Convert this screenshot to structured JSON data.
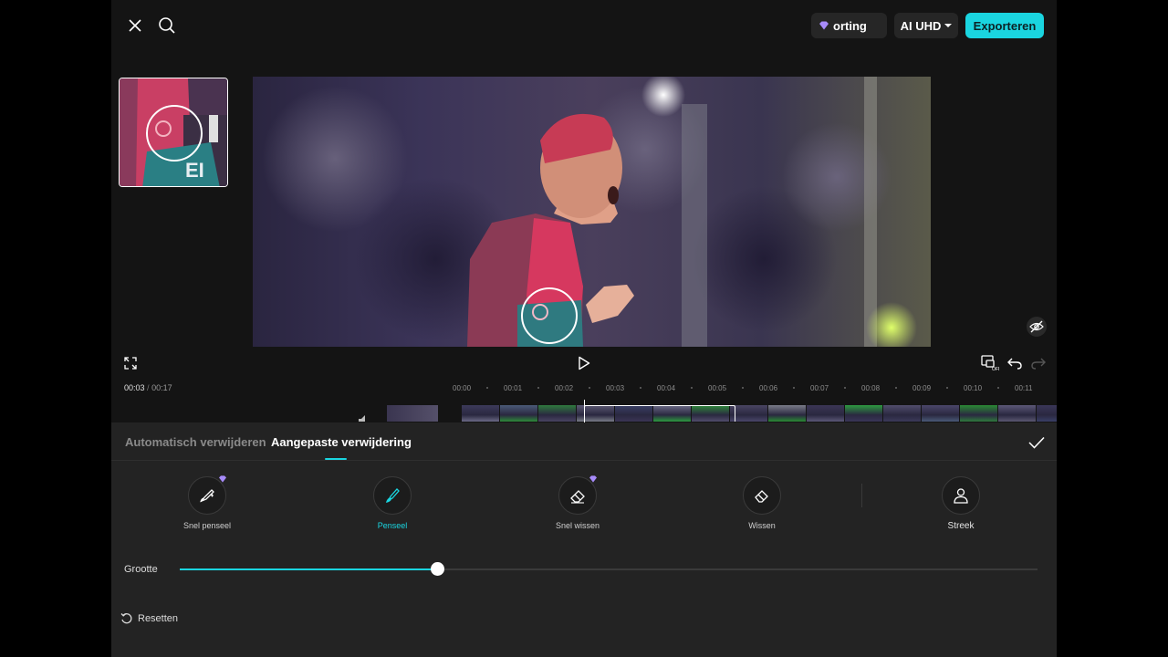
{
  "topbar": {
    "close_icon": "close-icon",
    "search_icon": "search-icon",
    "pro_label": "orting",
    "quality_label": "AI UHD",
    "export_label": "Exporteren"
  },
  "preview": {
    "fullscreen_icon": "fullscreen-icon",
    "play_icon": "play-icon",
    "hide_icon": "eye-off-icon"
  },
  "controls": {
    "keyframe_icon": "keyframe-off-icon",
    "undo_icon": "undo-icon",
    "redo_icon": "redo-icon"
  },
  "timeline": {
    "current_time": "00:03",
    "separator": "/",
    "total_time": "00:17",
    "ticks": [
      "00:00",
      "00:01",
      "00:02",
      "00:03",
      "00:04",
      "00:05",
      "00:06",
      "00:07",
      "00:08",
      "00:09",
      "00:10",
      "00:11"
    ]
  },
  "panel": {
    "tabs": [
      {
        "label": "Automatisch verwijderen",
        "active": false
      },
      {
        "label": "Aangepaste verwijdering",
        "active": true
      }
    ],
    "confirm_icon": "check-icon",
    "tools": [
      {
        "label": "Snel penseel",
        "icon": "quick-brush-icon",
        "premium": true,
        "active": false
      },
      {
        "label": "Penseel",
        "icon": "brush-icon",
        "premium": false,
        "active": true
      },
      {
        "label": "Snel wissen",
        "icon": "quick-eraser-icon",
        "premium": true,
        "active": false
      },
      {
        "label": "Wissen",
        "icon": "eraser-icon",
        "premium": false,
        "active": false
      },
      {
        "label": "Streek",
        "icon": "person-icon",
        "premium": false,
        "active": false
      }
    ],
    "size_label": "Grootte",
    "size_value": 0.3,
    "reset_label": "Resetten"
  },
  "colors": {
    "accent": "#1ad5e0",
    "mask": "#e0324c",
    "premium": "#a78bfa"
  }
}
